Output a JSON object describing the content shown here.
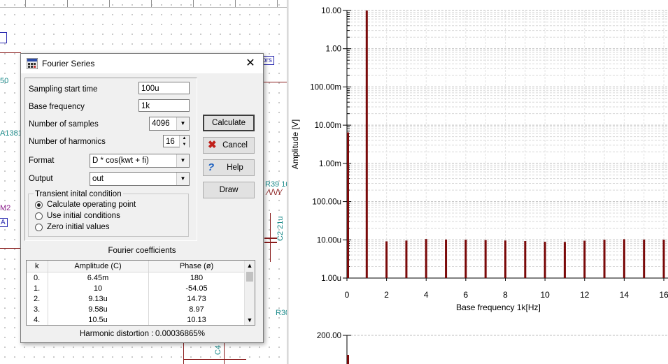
{
  "dialog": {
    "title": "Fourier Series",
    "close_symbol": "✕",
    "fields": {
      "sampling_start_time": {
        "label": "Sampling start time",
        "value": "100u"
      },
      "base_frequency": {
        "label": "Base frequency",
        "value": "1k"
      },
      "number_of_samples": {
        "label": "Number of samples",
        "value": "4096"
      },
      "number_of_harmonics": {
        "label": "Number of harmonics",
        "value": "16"
      },
      "format": {
        "label": "Format",
        "value": "D * cos(kwt + fi)"
      },
      "output": {
        "label": "Output",
        "value": "out"
      }
    },
    "transient": {
      "title": "Transient inital condition",
      "options": [
        "Calculate operating point",
        "Use initial conditions",
        "Zero initial values"
      ],
      "selected": 0
    },
    "buttons": {
      "calculate": "Calculate",
      "cancel": "Cancel",
      "help": "Help",
      "draw": "Draw"
    },
    "coefficients": {
      "title": "Fourier coefficients",
      "columns": [
        "k",
        "Amplitude (C)",
        "Phase (ø)"
      ],
      "rows": [
        [
          "0.",
          "6.45m",
          "180"
        ],
        [
          "1.",
          "10",
          "-54.05"
        ],
        [
          "2.",
          "9.13u",
          "14.73"
        ],
        [
          "3.",
          "9.58u",
          "8.97"
        ],
        [
          "4.",
          "10.5u",
          "10.13"
        ]
      ]
    },
    "distortion": {
      "label": "Harmonic distortion :",
      "value": "0.00036865%"
    }
  },
  "schematic": {
    "labels": [
      "50",
      "A1381",
      "M2",
      "A",
      "R39 10",
      "C2 21u",
      "R30",
      "C4",
      "ors"
    ]
  },
  "chart_data": [
    {
      "type": "bar",
      "scale": "log",
      "ylabel": "Amplitude [V]",
      "xlabel": "Base frequency 1k[Hz]",
      "y_tick_labels": [
        "10.00",
        "1.00",
        "100.00m",
        "10.00m",
        "1.00m",
        "100.00u",
        "10.00u",
        "1.00u"
      ],
      "x_tick_labels": [
        "0",
        "2",
        "4",
        "6",
        "8",
        "10",
        "12",
        "14",
        "16"
      ],
      "xlim": [
        0,
        16
      ],
      "ylim": [
        1e-06,
        10
      ],
      "categories": [
        0,
        1,
        2,
        3,
        4,
        5,
        6,
        7,
        8,
        9,
        10,
        11,
        12,
        13,
        14,
        15,
        16
      ],
      "values": [
        0.00645,
        10,
        9.13e-06,
        9.58e-06,
        1.05e-05,
        1.02e-05,
        1.01e-05,
        9.9e-06,
        9.6e-06,
        9.3e-06,
        8.9e-06,
        8.8e-06,
        9.5e-06,
        1.01e-05,
        1.04e-05,
        1.02e-05,
        1.01e-05
      ],
      "bar_color": "#7a0a0a",
      "grid": true
    },
    {
      "type": "bar",
      "y_tick_labels": [
        "200.00"
      ]
    }
  ]
}
